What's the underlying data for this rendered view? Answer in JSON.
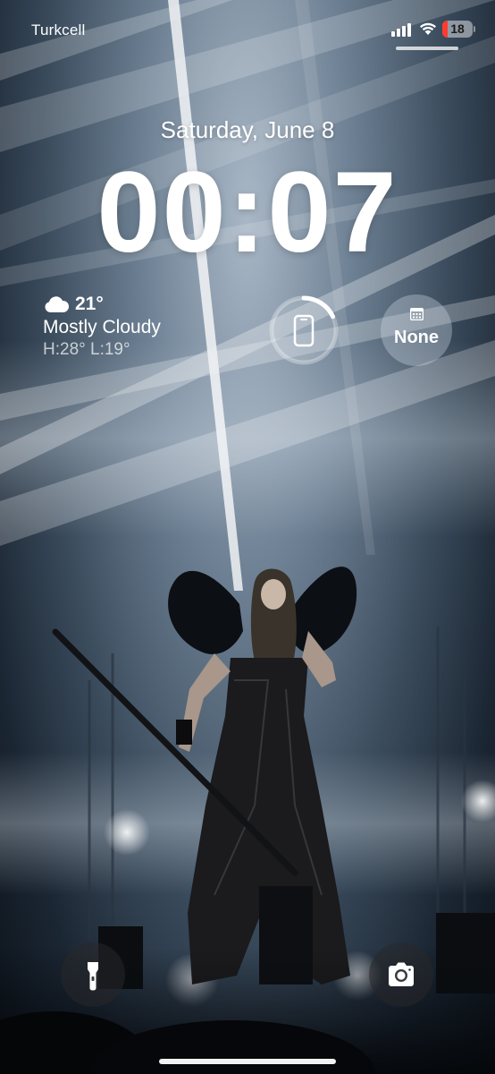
{
  "status_bar": {
    "carrier": "Turkcell",
    "battery_level": "18",
    "battery_color": "#ff3b30",
    "signal_bars": 4,
    "icons": [
      "cellular-signal-icon",
      "wifi-icon",
      "battery-icon"
    ]
  },
  "lock_screen": {
    "date": "Saturday, June 8",
    "time": "00:07"
  },
  "weather_widget": {
    "icon": "cloud-icon",
    "temperature": "21°",
    "condition": "Mostly Cloudy",
    "high_low": "H:28° L:19°"
  },
  "battery_widget": {
    "icon": "phone-icon",
    "level_fraction": 0.18,
    "ring_color": "#ffffff"
  },
  "calendar_widget": {
    "icon": "calendar-icon",
    "label": "None"
  },
  "bottom_controls": {
    "left_icon": "flashlight-icon",
    "right_icon": "camera-icon"
  },
  "wallpaper": {
    "subject": "concert-performer-image",
    "accent": "#c9d6e3"
  }
}
